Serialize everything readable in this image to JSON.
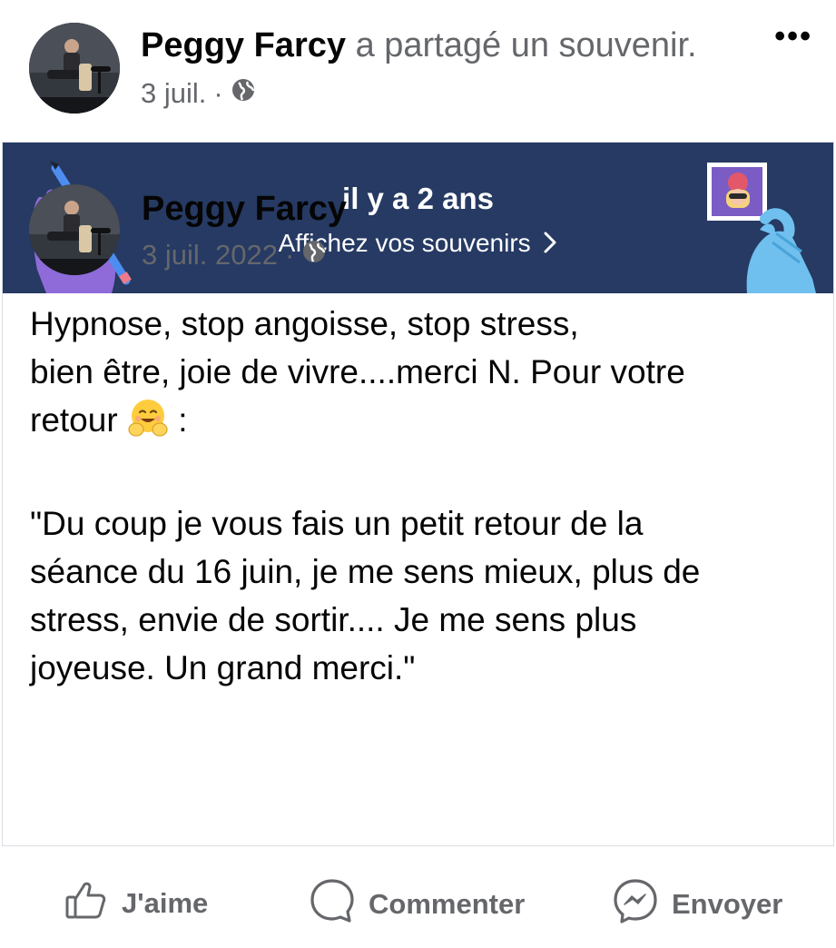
{
  "share_header": {
    "author": "Peggy Farcy",
    "action": "a partagé un souvenir.",
    "date": "3 juil.",
    "separator": "·",
    "privacy_icon": "globe-icon",
    "more_icon": "more-options-icon",
    "more_label": "•••"
  },
  "memory_banner": {
    "title": "il y a 2 ans",
    "link_label": "Affichez vos souvenirs",
    "chevron": "›",
    "background_color": "#263a63"
  },
  "original_post": {
    "author": "Peggy Farcy",
    "date": "3 juil. 2022",
    "separator": "·",
    "privacy_icon": "globe-icon",
    "lines": [
      "Hypnose, stop angoisse, stop stress,",
      "bien être, joie de vivre....merci N. Pour votre",
      "retour"
    ],
    "emoji_icon": "hugging-face-emoji",
    "after_emoji": " :",
    "quote_lines": [
      "\"Du coup je vous fais un petit retour de la",
      "séance du 16 juin, je  me sens mieux, plus de",
      "stress, envie de sortir.... Je me sens plus",
      "joyeuse. Un grand merci.\""
    ]
  },
  "actions": {
    "like_label": "J'aime",
    "comment_label": "Commenter",
    "send_label": "Envoyer",
    "like_icon": "thumbs-up-icon",
    "comment_icon": "comment-bubble-icon",
    "send_icon": "messenger-icon"
  }
}
